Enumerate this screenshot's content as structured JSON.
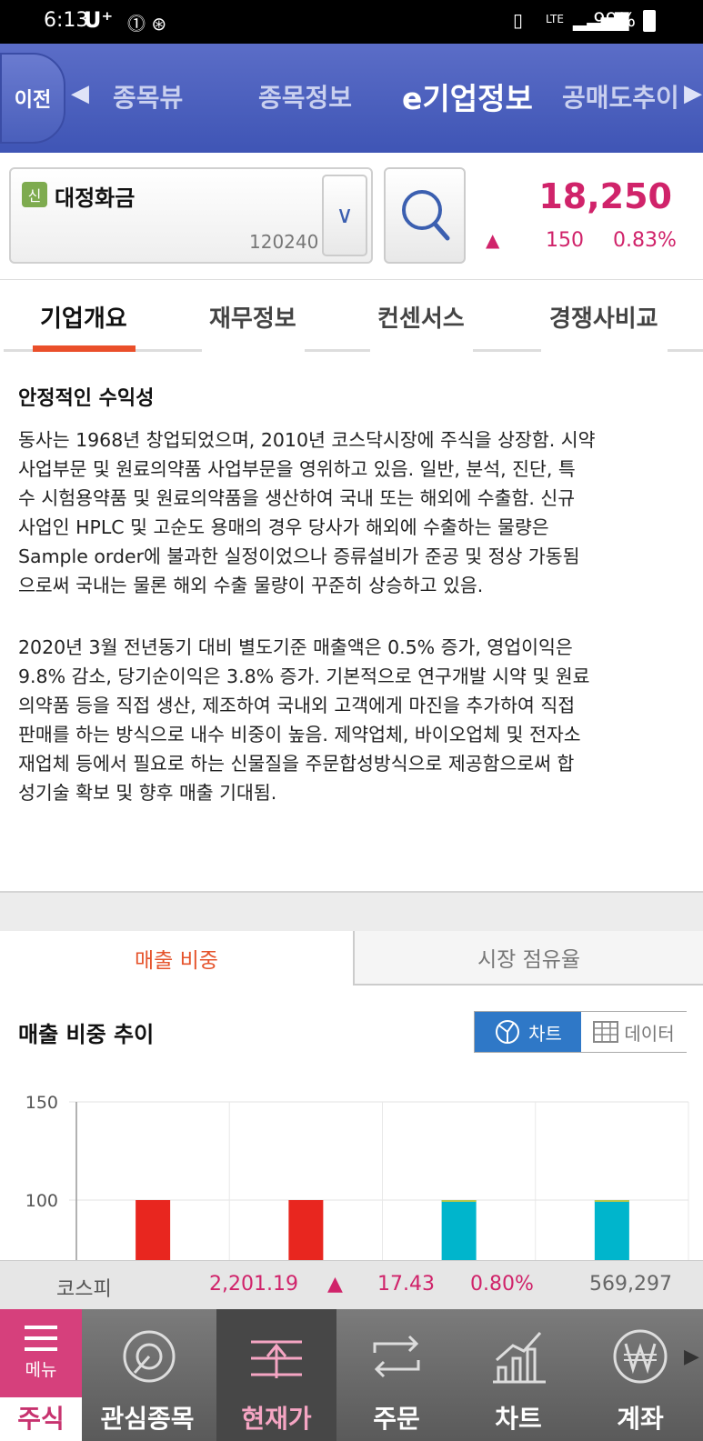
{
  "status": {
    "time": "6:13",
    "carrier": "U⁺",
    "battery": "99%",
    "network": "LTE"
  },
  "nav": {
    "back": "이전",
    "tabs": [
      "종목뷰",
      "종목정보",
      "e기업정보",
      "공매도추이"
    ],
    "active": "e기업정보"
  },
  "stock": {
    "badge": "신",
    "name": "대정화금",
    "code": "120240",
    "price": "18,250",
    "change": "150",
    "change_pct": "0.83%",
    "direction": "up"
  },
  "tabs": [
    "기업개요",
    "재무정보",
    "컨센서스",
    "경쟁사비교"
  ],
  "overview": {
    "title": "안정적인 수익성",
    "para1": [
      "동사는 1968년 창업되었으며, 2010년 코스닥시장에 주식을 상장함. 시약",
      "사업부문 및 원료의약품 사업부문을 영위하고 있음. 일반, 분석, 진단, 특",
      "수 시험용약품 및 원료의약품을 생산하여 국내 또는 해외에 수출함. 신규",
      "사업인 HPLC 및 고순도 용매의 경우 당사가 해외에 수출하는 물량은",
      "Sample order에 불과한 실정이었으나 증류설비가 준공 및 정상 가동됨",
      "으로써 국내는 물론 해외 수출 물량이 꾸준히 상승하고 있음."
    ],
    "para2": [
      "2020년 3월 전년동기 대비 별도기준 매출액은 0.5% 증가, 영업이익은",
      "9.8% 감소, 당기순이익은 3.8% 증가. 기본적으로 연구개발 시약 및 원료",
      "의약품 등을 직접 생산, 제조하여 국내외 고객에게 마진을 추가하여 직접",
      "판매를 하는 방식으로 내수 비중이 높음. 제약업체, 바이오업체 및 전자소",
      "재업체 등에서 필요로 하는 신물질을 주문합성방식으로 제공함으로써 합",
      "성기술 확보 및 향후 매출 기대됨."
    ]
  },
  "subtabs": [
    "매출 비중",
    "시장 점유율"
  ],
  "section_title": "매출 비중 추이",
  "toggle": {
    "chart": "차트",
    "data": "데이터"
  },
  "chart_data": {
    "type": "bar",
    "ytick_labels": [
      "150",
      "100"
    ],
    "ylim_visible": [
      75,
      150
    ],
    "values": [
      100,
      100,
      100,
      100
    ],
    "colors": [
      "#e8261f",
      "#e8261f",
      "#00b5cc",
      "#00b5cc"
    ]
  },
  "index": {
    "name": "코스피",
    "value": "2,201.19",
    "change": "17.43",
    "pct": "0.80%",
    "volume": "569,297"
  },
  "bottomnav": {
    "menu_icon_label": "메뉴",
    "items": [
      "주식",
      "관심종목",
      "현재가",
      "주문",
      "차트",
      "계좌"
    ],
    "active": "현재가"
  }
}
